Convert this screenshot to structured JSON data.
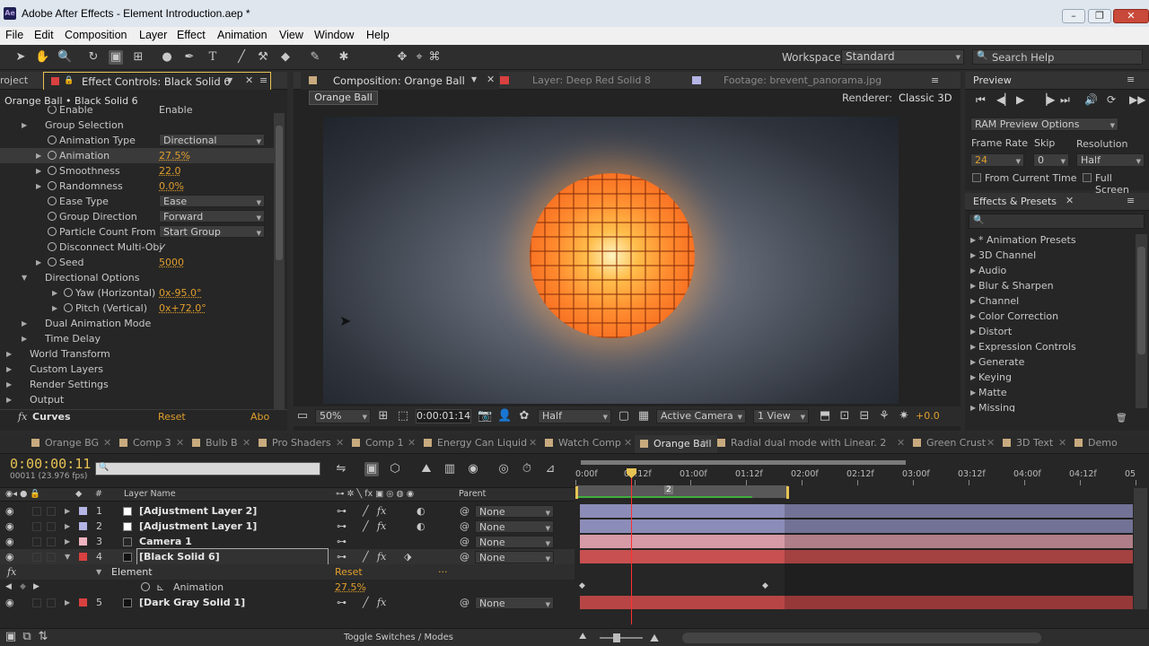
{
  "window": {
    "title": "Adobe After Effects - Element Introduction.aep *",
    "app_icon": "Ae",
    "min": "–",
    "max": "❐",
    "close": "✕"
  },
  "menu": [
    "File",
    "Edit",
    "Composition",
    "Layer",
    "Effect",
    "Animation",
    "View",
    "Window",
    "Help"
  ],
  "toolbar": {
    "workspace_label": "Workspace:",
    "workspace_value": "Standard",
    "search_placeholder": "Search Help"
  },
  "effect_controls": {
    "project_tab": "roject",
    "tab": "Effect Controls: Black Solid 6",
    "breadcrumb": "Orange Ball • Black Solid 6",
    "rows": [
      {
        "label": "Enable",
        "value": "Enable"
      },
      {
        "label": "Group Selection"
      },
      {
        "label": "Animation Type",
        "value": "Directional"
      },
      {
        "label": "Animation",
        "value": "27.5%"
      },
      {
        "label": "Smoothness",
        "value": "22.0"
      },
      {
        "label": "Randomness",
        "value": "0.0%"
      },
      {
        "label": "Ease Type",
        "value": "Ease"
      },
      {
        "label": "Group Direction",
        "value": "Forward"
      },
      {
        "label": "Particle Count From",
        "value": "Start Group"
      },
      {
        "label": "Disconnect Multi-Obj",
        "value": "✓"
      },
      {
        "label": "Seed",
        "value": "5000"
      },
      {
        "label": "Directional Options"
      },
      {
        "label": "Yaw (Horizontal)",
        "value": "0x-95.0°"
      },
      {
        "label": "Pitch (Vertical)",
        "value": "0x+72.0°"
      },
      {
        "label": "Dual Animation Mode"
      },
      {
        "label": "Time Delay"
      },
      {
        "label": "World Transform"
      },
      {
        "label": "Custom Layers"
      },
      {
        "label": "Render Settings"
      },
      {
        "label": "Output"
      }
    ],
    "curves": {
      "fx": "fx",
      "label": "Curves",
      "reset": "Reset",
      "about": "Abo"
    }
  },
  "composition": {
    "tab_comp": "Composition: Orange Ball",
    "tab_layer": "Layer: Deep Red Solid 8",
    "tab_footage": "Footage: brevent_panorama.jpg",
    "comp_name": "Orange Ball",
    "renderer_label": "Renderer:",
    "renderer_value": "Classic 3D",
    "zoom": "50%",
    "timecode": "0:00:01:14",
    "resolution": "Half",
    "camera": "Active Camera",
    "views": "1 View",
    "exposure": "+0.0"
  },
  "preview": {
    "tab": "Preview",
    "ram_options": "RAM Preview Options",
    "frame_rate_label": "Frame Rate",
    "skip_label": "Skip",
    "resolution_label": "Resolution",
    "frame_rate": "24",
    "skip": "0",
    "resolution": "Half",
    "from_current": "From Current Time",
    "full_screen": "Full Screen"
  },
  "effects_presets": {
    "tab": "Effects & Presets",
    "items": [
      "* Animation Presets",
      "3D Channel",
      "Audio",
      "Blur & Sharpen",
      "Channel",
      "Color Correction",
      "Distort",
      "Expression Controls",
      "Generate",
      "Keying",
      "Matte",
      "Missing"
    ]
  },
  "timeline": {
    "tabs": [
      "Orange BG",
      "Comp 3",
      "Bulb B",
      "Pro Shaders",
      "Comp 1",
      "Energy Can Liquid",
      "Watch Comp",
      "Orange Ball",
      "Radial dual mode with Linear. 2",
      "Green Crust",
      "3D Text",
      "Demo"
    ],
    "active_tab": "Orange Ball",
    "timecode": "0:00:00:11",
    "fps": "00011 (23.976 fps)",
    "col_layer_name": "Layer Name",
    "col_parent": "Parent",
    "col_num": "#",
    "ruler": [
      "0:00f",
      "00:12f",
      "01:00f",
      "01:12f",
      "02:00f",
      "02:12f",
      "03:00f",
      "03:12f",
      "04:00f",
      "04:12f",
      "05"
    ],
    "work_area_label": "2",
    "layers": [
      {
        "num": "1",
        "name": "[Adjustment Layer 2]",
        "color": "#b4b4e6",
        "parent": "None",
        "bar": "#8c8cb8"
      },
      {
        "num": "2",
        "name": "[Adjustment Layer 1]",
        "color": "#b4b4e6",
        "parent": "None",
        "bar": "#8c8cb8"
      },
      {
        "num": "3",
        "name": "Camera 1",
        "color": "#f0b4c0",
        "parent": "None",
        "bar": "#d69aa6"
      },
      {
        "num": "4",
        "name": "[Black Solid 6]",
        "color": "#d94040",
        "parent": "None",
        "bar": "#c85050"
      },
      {
        "num": "5",
        "name": "[Dark Gray Solid 1]",
        "color": "#d94040",
        "parent": "None",
        "bar": "#b84545"
      }
    ],
    "element_label": "Element",
    "element_reset": "Reset",
    "element_dots": "...",
    "animation_label": "Animation",
    "animation_value": "27.5%",
    "toggle_label": "Toggle Switches / Modes"
  }
}
